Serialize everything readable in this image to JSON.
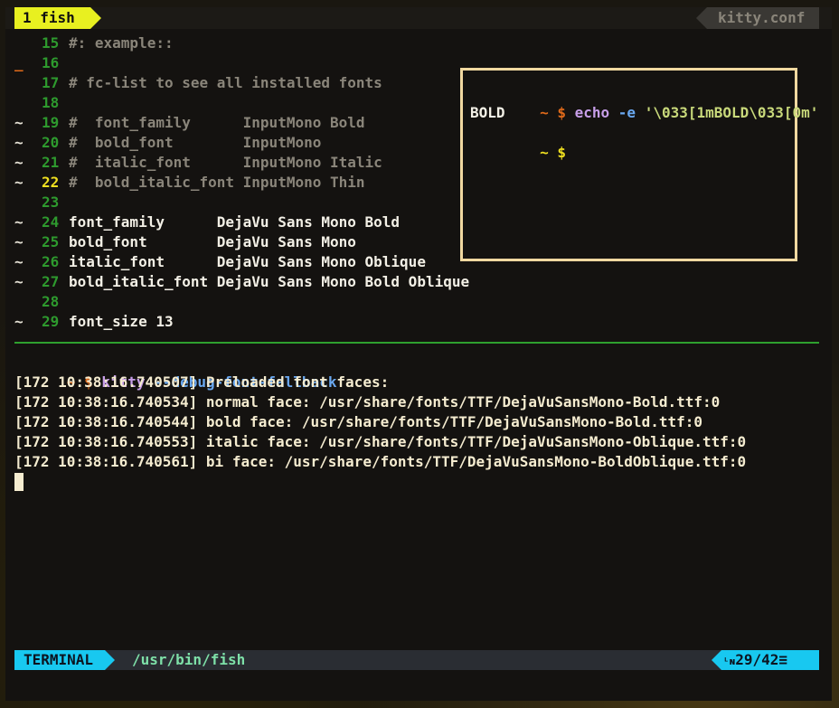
{
  "tabbar": {
    "tab_label": "1 fish",
    "config_name": "kitty.conf"
  },
  "editor": {
    "lines": [
      {
        "marker": "",
        "num": "15",
        "text": "#: example::",
        "style": "comment"
      },
      {
        "marker": "_",
        "num": "16",
        "text": "",
        "style": "comment"
      },
      {
        "marker": "",
        "num": "17",
        "text": "# fc-list to see all installed fonts",
        "style": "comment"
      },
      {
        "marker": "",
        "num": "18",
        "text": "",
        "style": "comment"
      },
      {
        "marker": "~",
        "num": "19",
        "text": "#  font_family      InputMono Bold",
        "style": "comment"
      },
      {
        "marker": "~",
        "num": "20",
        "text": "#  bold_font        InputMono",
        "style": "comment"
      },
      {
        "marker": "~",
        "num": "21",
        "text": "#  italic_font      InputMono Italic",
        "style": "comment"
      },
      {
        "marker": "~",
        "num": "22",
        "text": "#  bold_italic_font InputMono Thin",
        "style": "comment",
        "current": true
      },
      {
        "marker": "",
        "num": "23",
        "text": "",
        "style": "comment"
      },
      {
        "marker": "~",
        "num": "24",
        "text": "font_family      DejaVu Sans Mono Bold",
        "style": "code"
      },
      {
        "marker": "~",
        "num": "25",
        "text": "bold_font        DejaVu Sans Mono",
        "style": "code"
      },
      {
        "marker": "~",
        "num": "26",
        "text": "italic_font      DejaVu Sans Mono Oblique",
        "style": "code"
      },
      {
        "marker": "~",
        "num": "27",
        "text": "bold_italic_font DejaVu Sans Mono Bold Oblique",
        "style": "code"
      },
      {
        "marker": "",
        "num": "28",
        "text": "",
        "style": "code"
      },
      {
        "marker": "~",
        "num": "29",
        "text": "font_size 13",
        "style": "code"
      }
    ]
  },
  "popup": {
    "prompt_tilde": "~",
    "prompt_dollar": "$",
    "cmd": "echo",
    "flag": "-e",
    "arg": "'\\033[1mBOLD\\033[0m'",
    "output": "BOLD",
    "prompt2_tilde": "~",
    "prompt2_dollar": "$"
  },
  "shell": {
    "prompt_tilde": "~",
    "prompt_dollar": "$",
    "cmd": "kitty",
    "flag": "--debug-font-fallback",
    "output": [
      "[172 10:38:16.740507] Preloaded font faces:",
      "[172 10:38:16.740534] normal face: /usr/share/fonts/TTF/DejaVuSansMono-Bold.ttf:0",
      "[172 10:38:16.740544] bold face: /usr/share/fonts/TTF/DejaVuSansMono-Bold.ttf:0",
      "[172 10:38:16.740553] italic face: /usr/share/fonts/TTF/DejaVuSansMono-Oblique.ttf:0",
      "[172 10:38:16.740561] bi face: /usr/share/fonts/TTF/DejaVuSansMono-BoldOblique.ttf:0"
    ]
  },
  "statusline": {
    "mode": "TERMINAL",
    "path": "/usr/bin/fish",
    "ln_glyph": "ᴸɴ",
    "position": "29/42",
    "menu_glyph": "≡"
  },
  "colors": {
    "tab_active_bg": "#e8f020",
    "separator": "#2ea02e",
    "popup_border": "#f0d8a0",
    "statusline_accent": "#18c8f0",
    "statusline_bg": "#2a2d33"
  }
}
